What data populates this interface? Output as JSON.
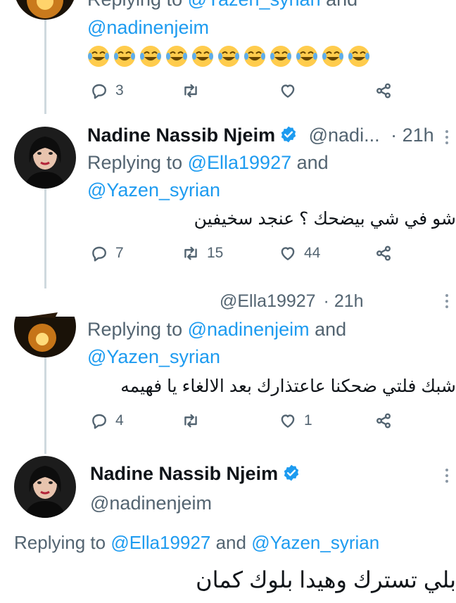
{
  "tweet0": {
    "reply_prefix": "Replying to ",
    "reply_to_1": "@Yazen_syrian",
    "reply_and": " and",
    "reply_to_2": "@nadinenjeim",
    "emoji_row": "😂😂😂😂😂😂😂😂😂😂😂",
    "replies": "3",
    "retweets": "",
    "likes": ""
  },
  "tweet1": {
    "name": "Nadine Nassib Njeim",
    "handle": "@nadi...",
    "time": "· 21h",
    "reply_prefix": "Replying to ",
    "reply_to_1": "@Ella19927",
    "reply_and": " and",
    "reply_to_2": "@Yazen_syrian",
    "text": "شو في شي بيضحك ؟ عنجد سخيفين",
    "replies": "7",
    "retweets": "15",
    "likes": "44"
  },
  "tweet2": {
    "handle": "@Ella19927",
    "time": "· 21h",
    "reply_prefix": "Replying to ",
    "reply_to_1": "@nadinenjeim",
    "reply_and": " and",
    "reply_to_2": "@Yazen_syrian",
    "text": "شبك فلتي ضحكنا عاعتذارك بعد الالغاء يا فهيمه",
    "replies": "4",
    "retweets": "",
    "likes": "1"
  },
  "tweet3": {
    "name": "Nadine Nassib Njeim",
    "handle": "@nadinenjeim",
    "reply_prefix": "Replying to ",
    "reply_to_1": "@Ella19927",
    "reply_and": " and ",
    "reply_to_2": "@Yazen_syrian",
    "text": "بلي تسترك وهيدا بلوك كمان"
  },
  "colors": {
    "accent": "#1d9bf0",
    "secondary_text": "#536471",
    "thread_line": "#cfd9de"
  },
  "icons": [
    "reply-icon",
    "retweet-icon",
    "like-icon",
    "share-icon",
    "verified-badge-icon",
    "more-icon"
  ]
}
